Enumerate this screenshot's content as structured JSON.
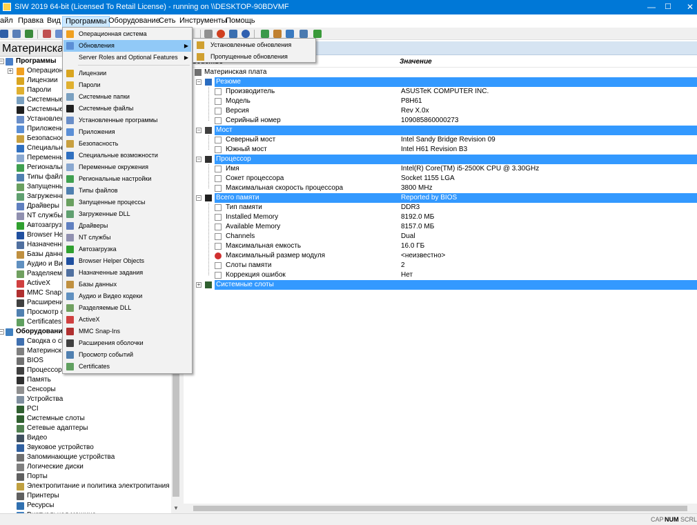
{
  "window": {
    "title": "SIW 2019 64-bit (Licensed To Retail License) - running on \\\\DESKTOP-90BDVMF",
    "minimize": "—",
    "maximize": "☐",
    "close": "✕"
  },
  "menubar": [
    "айл",
    "Правка",
    "Вид",
    "Программы",
    "Оборудование",
    "Сеть",
    "Инструменты",
    "Помощь"
  ],
  "left_panel": {
    "title": "Материнская",
    "tree": [
      {
        "label": "Программы",
        "bold": true,
        "icon": "programs-icon",
        "color": "#4a7fc8"
      },
      {
        "label": "Операционн",
        "icon": "os-icon",
        "color": "#f0a020"
      },
      {
        "label": "Лицензии",
        "icon": "license-icon",
        "color": "#d9a520"
      },
      {
        "label": "Пароли",
        "icon": "key-icon",
        "color": "#e0b030"
      },
      {
        "label": "Системные",
        "icon": "folder-icon",
        "color": "#7aa0c0"
      },
      {
        "label": "Системные",
        "icon": "console-icon",
        "color": "#202020"
      },
      {
        "label": "Установлен",
        "icon": "installer-icon",
        "color": "#6a8ec8"
      },
      {
        "label": "Приложени",
        "icon": "app-icon",
        "color": "#5b8fd6"
      },
      {
        "label": "Безопаснос",
        "icon": "shield-icon",
        "color": "#c8a040"
      },
      {
        "label": "Специальн",
        "icon": "accessibility-icon",
        "color": "#3070c0"
      },
      {
        "label": "Переменны",
        "icon": "env-icon",
        "color": "#8aa8d0"
      },
      {
        "label": "Региональн",
        "icon": "globe-icon",
        "color": "#40a050"
      },
      {
        "label": "Типы файло",
        "icon": "filetype-icon",
        "color": "#5080b0"
      },
      {
        "label": "Запущенны",
        "icon": "process-icon",
        "color": "#6aa060"
      },
      {
        "label": "Загруженны",
        "icon": "dll-icon",
        "color": "#60a070"
      },
      {
        "label": "Драйверы",
        "icon": "gear-icon",
        "color": "#6080c0"
      },
      {
        "label": "NT службы",
        "icon": "service-icon",
        "color": "#9090b0"
      },
      {
        "label": "Автозагрузк",
        "icon": "startup-icon",
        "color": "#30a030"
      },
      {
        "label": "Browser Help",
        "icon": "browser-icon",
        "color": "#2050a0"
      },
      {
        "label": "Назначенны",
        "icon": "tasks-icon",
        "color": "#5070a0"
      },
      {
        "label": "Базы данны",
        "icon": "database-icon",
        "color": "#c09040"
      },
      {
        "label": "Аудио и Вид",
        "icon": "media-icon",
        "color": "#6090c0"
      },
      {
        "label": "Разделяемы",
        "icon": "shared-dll-icon",
        "color": "#70a060"
      },
      {
        "label": "ActiveX",
        "icon": "activex-icon",
        "color": "#d04040"
      },
      {
        "label": "MMC Snap-",
        "icon": "mmc-icon",
        "color": "#b03030"
      },
      {
        "label": "Расширени",
        "icon": "shell-ext-icon",
        "color": "#404040"
      },
      {
        "label": "Просмотр с",
        "icon": "event-icon",
        "color": "#5080b0"
      },
      {
        "label": "Certificates",
        "icon": "certificate-icon",
        "color": "#60a060"
      },
      {
        "label": "Оборудование",
        "bold": true,
        "icon": "hardware-icon",
        "color": "#4080c0"
      },
      {
        "label": "Сводка о сі",
        "icon": "summary-icon",
        "color": "#4070b0"
      },
      {
        "label": "Материнск",
        "icon": "motherboard-icon",
        "color": "#808080"
      },
      {
        "label": "BIOS",
        "icon": "bios-icon",
        "color": "#707070"
      },
      {
        "label": "Процессор",
        "icon": "cpu-icon",
        "color": "#404040"
      },
      {
        "label": "Память",
        "icon": "memory-icon",
        "color": "#303030"
      },
      {
        "label": "Сенсоры",
        "icon": "sensor-icon",
        "color": "#909090"
      },
      {
        "label": "Устройства",
        "icon": "devices-icon",
        "color": "#8090a0"
      },
      {
        "label": "PCI",
        "icon": "pci-icon",
        "color": "#306030"
      },
      {
        "label": "Системные слоты",
        "icon": "slot-icon",
        "color": "#306030"
      },
      {
        "label": "Сетевые адаптеры",
        "icon": "network-icon",
        "color": "#508050"
      },
      {
        "label": "Видео",
        "icon": "video-icon",
        "color": "#405060"
      },
      {
        "label": "Звуковое устройство",
        "icon": "sound-icon",
        "color": "#3060a0"
      },
      {
        "label": "Запоминающие устройства",
        "icon": "storage-icon",
        "color": "#707070"
      },
      {
        "label": "Логические диски",
        "icon": "disk-icon",
        "color": "#808080"
      },
      {
        "label": "Порты",
        "icon": "port-icon",
        "color": "#606060"
      },
      {
        "label": "Электропитание и политика электропитания",
        "icon": "power-icon",
        "color": "#c0a040"
      },
      {
        "label": "Принтеры",
        "icon": "printer-icon",
        "color": "#606060"
      },
      {
        "label": "Ресурсы",
        "icon": "resources-icon",
        "color": "#3070b0"
      },
      {
        "label": "Виртуальная машина",
        "icon": "vm-icon",
        "color": "#4080c0"
      }
    ]
  },
  "grid": {
    "col_property": "Свойство",
    "col_value": "Значение",
    "root_label": "Материнская плата",
    "sections": [
      {
        "label": "Резюме",
        "value": "",
        "icon": "summary-icon",
        "rows": [
          {
            "label": "Производитель",
            "value": "ASUSTeK COMPUTER INC."
          },
          {
            "label": "Модель",
            "value": "P8H61"
          },
          {
            "label": "Версия",
            "value": "Rev X.0x"
          },
          {
            "label": "Серийный номер",
            "value": "109085860000273"
          }
        ]
      },
      {
        "label": "Мост",
        "value": "",
        "icon": "bridge-icon",
        "rows": [
          {
            "label": "Северный мост",
            "value": "Intel Sandy Bridge Revision 09"
          },
          {
            "label": "Южный мост",
            "value": "Intel H61 Revision B3"
          }
        ]
      },
      {
        "label": "Процессор",
        "value": "",
        "icon": "cpu-icon",
        "rows": [
          {
            "label": "Имя",
            "value": "Intel(R) Core(TM) i5-2500K CPU @ 3.30GHz"
          },
          {
            "label": "Сокет процессора",
            "value": "Socket 1155 LGA"
          },
          {
            "label": "Максимальная скорость процессора",
            "value": "3800 MHz"
          }
        ]
      },
      {
        "label": "Всего памяти",
        "value": "Reported by BIOS",
        "icon": "memory-icon",
        "rows": [
          {
            "label": "Тип памяти",
            "value": "DDR3"
          },
          {
            "label": "Installed Memory",
            "value": "8192.0 МБ"
          },
          {
            "label": "Available Memory",
            "value": "8157.0 МБ"
          },
          {
            "label": "Channels",
            "value": "Dual"
          },
          {
            "label": "Максимальная емкость",
            "value": "16.0 ГБ"
          },
          {
            "label": "Максимальный размер модуля",
            "value": "<неизвестно>",
            "error": true
          },
          {
            "label": "Слоты памяти",
            "value": "2"
          },
          {
            "label": "Коррекция ошибок",
            "value": "Нет"
          }
        ]
      },
      {
        "label": "Системные слоты",
        "value": "",
        "icon": "slot-icon",
        "rows": []
      }
    ]
  },
  "programs_menu": {
    "items": [
      {
        "label": "Операционная система",
        "icon": "os-icon",
        "color": "#f0a020"
      },
      {
        "label": "Обновления",
        "icon": "updates-icon",
        "color": "#5b8fd6",
        "submenu": true,
        "highlighted": true
      },
      {
        "label": "Server Roles and Optional Features",
        "icon": "",
        "color": "",
        "submenu": true
      },
      {
        "separator": true
      },
      {
        "label": "Лицензии",
        "icon": "license-icon",
        "color": "#d9a520"
      },
      {
        "label": "Пароли",
        "icon": "key-icon",
        "color": "#e0b030"
      },
      {
        "label": "Системные папки",
        "icon": "folder-icon",
        "color": "#7aa0c0"
      },
      {
        "label": "Системные файлы",
        "icon": "console-icon",
        "color": "#202020"
      },
      {
        "label": "Установленные программы",
        "icon": "installer-icon",
        "color": "#6a8ec8"
      },
      {
        "label": "Приложения",
        "icon": "app-icon",
        "color": "#5b8fd6"
      },
      {
        "label": "Безопасность",
        "icon": "shield-icon",
        "color": "#c8a040"
      },
      {
        "label": "Специальные возможности",
        "icon": "accessibility-icon",
        "color": "#3070c0"
      },
      {
        "label": "Переменные окружения",
        "icon": "env-icon",
        "color": "#8aa8d0"
      },
      {
        "label": "Региональные настройки",
        "icon": "globe-icon",
        "color": "#40a050"
      },
      {
        "label": "Типы файлов",
        "icon": "filetype-icon",
        "color": "#5080b0"
      },
      {
        "label": "Запущенные процессы",
        "icon": "process-icon",
        "color": "#6aa060"
      },
      {
        "label": "Загруженные DLL",
        "icon": "dll-icon",
        "color": "#60a070"
      },
      {
        "label": "Драйверы",
        "icon": "gear-icon",
        "color": "#6080c0"
      },
      {
        "label": "NT службы",
        "icon": "service-icon",
        "color": "#9090b0"
      },
      {
        "label": "Автозагрузка",
        "icon": "startup-icon",
        "color": "#30a030"
      },
      {
        "label": "Browser Helper Objects",
        "icon": "browser-icon",
        "color": "#2050a0"
      },
      {
        "label": "Назначенные задания",
        "icon": "tasks-icon",
        "color": "#5070a0"
      },
      {
        "label": "Базы данных",
        "icon": "database-icon",
        "color": "#c09040"
      },
      {
        "label": "Аудио и Видео кодеки",
        "icon": "media-icon",
        "color": "#6090c0"
      },
      {
        "label": "Разделяемые DLL",
        "icon": "shared-dll-icon",
        "color": "#70a060"
      },
      {
        "label": "ActiveX",
        "icon": "activex-icon",
        "color": "#d04040"
      },
      {
        "label": "MMC Snap-Ins",
        "icon": "mmc-icon",
        "color": "#b03030"
      },
      {
        "label": "Расширения оболочки",
        "icon": "shell-ext-icon",
        "color": "#404040"
      },
      {
        "label": "Просмотр событий",
        "icon": "event-icon",
        "color": "#5080b0"
      },
      {
        "label": "Certificates",
        "icon": "certificate-icon",
        "color": "#60a060"
      }
    ]
  },
  "updates_submenu": {
    "items": [
      {
        "label": "Установленные обновления",
        "icon": "installed-updates-icon",
        "color": "#d0a030"
      },
      {
        "label": "Пропущенные обновления",
        "icon": "missing-updates-icon",
        "color": "#d0a030"
      }
    ]
  },
  "statusbar": {
    "cap": "CAP",
    "num": "NUM",
    "scrl": "SCRL"
  },
  "colors": {
    "titlebar": "#0078d7",
    "section_highlight": "#3399ff",
    "menu_highlight": "#91c9f7"
  }
}
